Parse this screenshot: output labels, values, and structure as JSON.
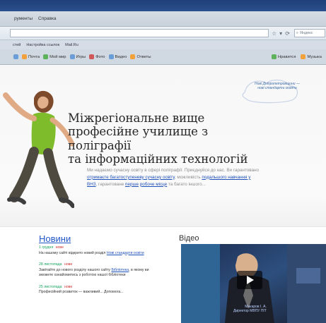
{
  "browser": {
    "menu": [
      "рументы",
      "Справка"
    ],
    "address": {
      "value": "",
      "placeholder": ""
    },
    "search": {
      "placeholder": "Яндекс"
    },
    "bookmarks": [
      "стей",
      "Настройка ссылок",
      "Mail.Ru"
    ],
    "toolbar": [
      "Почта",
      "Мой мир",
      "Игры",
      "Фото",
      "Видео",
      "Ответы"
    ],
    "toolbar_right": [
      "Нравится",
      "Музыка"
    ]
  },
  "site": {
    "logo_text": "Нові Дніпропетровщини — нові стандарти освіти",
    "title_lines": [
      "Міжрегіональне вище",
      "професійне училище з поліграфії",
      "та інформаційних технологій"
    ],
    "description": {
      "part1": "Ми надаємо сучасну освіту в сфері поліграфії. Приєднуйся до нас.",
      "part2": "Ви гарантовано",
      "link1": "отримаєте багатоступеневу сучасну освіту",
      "part3": "можливість",
      "link2": "подальшого навчання у ВНЗ",
      "part4": ", гарантоване",
      "link3": "перше",
      "link4": "робоче місце",
      "part5": "та багато іншого..."
    },
    "news": {
      "title": "Новини",
      "items": [
        {
          "date": "1 грудня",
          "badge": "нове",
          "text": "На нашому сайті відкрито новий розділ",
          "link": "Нові стандарти освіти"
        },
        {
          "date": "28 листопада",
          "badge": "нове",
          "text": "Завітайте до нового розділу нашого сайту",
          "link": "Бібліотека",
          "text2": ", в якому ви зможете ознайомитись з роботою нашої бібліотеки"
        },
        {
          "date": "25 листопада",
          "badge": "нове",
          "text": "Професійний розвиток — важливий... Допомога..."
        }
      ]
    },
    "video": {
      "title": "Відео",
      "caption_line1": "Макаров І. А.",
      "caption_line2": "Директор МВПУ ПІТ"
    }
  }
}
